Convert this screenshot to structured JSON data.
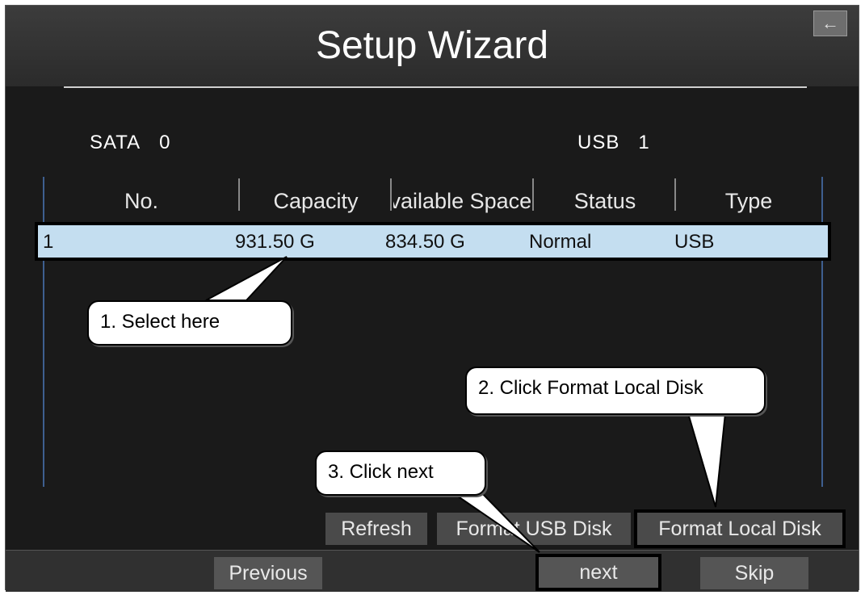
{
  "window": {
    "title": "Setup Wizard",
    "back_icon": "back-arrow-icon"
  },
  "summary": {
    "sata_label": "SATA",
    "sata_count": "0",
    "usb_label": "USB",
    "usb_count": "1"
  },
  "table": {
    "columns": [
      "No.",
      "Capacity",
      "Available Space",
      "Status",
      "Type"
    ],
    "rows": [
      {
        "no": "1",
        "capacity": "931.50 G",
        "available": "834.50 G",
        "status": "Normal",
        "type": "USB"
      }
    ]
  },
  "actions": {
    "refresh": "Refresh",
    "format_usb": "Format USB Disk",
    "format_local": "Format Local Disk"
  },
  "footer": {
    "previous": "Previous",
    "next": "next",
    "skip": "Skip"
  },
  "annotations": {
    "step1": "1. Select here",
    "step2": "2. Click Format Local Disk",
    "step3": "3. Click next"
  },
  "colors": {
    "selected_row": "#c4def0",
    "highlight_border": "#000000",
    "table_border": "#3e5f90"
  }
}
